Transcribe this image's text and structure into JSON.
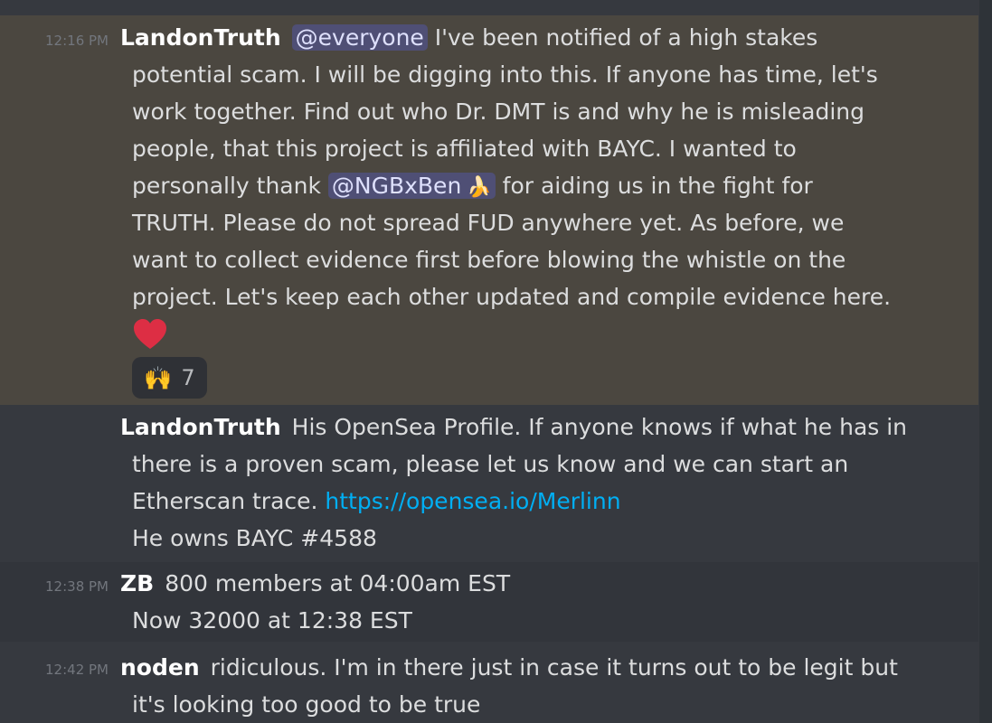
{
  "messages": [
    {
      "time": "12:16 PM",
      "author": "LandonTruth",
      "mention1": "@everyone",
      "line1_rest": " I've been notified of a high stakes",
      "line2": "potential scam.  I will be digging into this.  If anyone has time, let's",
      "line3": "work together. Find out who Dr. DMT is and why he is misleading",
      "line4": "people, that this project is affiliated with BAYC.  I wanted to",
      "line5_pre": "personally thank ",
      "mention2": "@NGBxBen",
      "mention2_emoji": "🍌",
      "line5_post": " for aiding us in the fight for",
      "line6": "TRUTH.  Please do not spread FUD anywhere yet. As before, we",
      "line7": "want to collect evidence first before blowing the whistle on the",
      "line8": "project.  Let's keep each other updated and compile evidence here.",
      "reaction_emoji": "🙌",
      "reaction_count": "7"
    },
    {
      "author": "LandonTruth",
      "line1_rest": "His OpenSea Profile.  If anyone knows if what he has in",
      "line2": "there is a proven scam, please let us know and we can start an",
      "line3_pre": "Etherscan trace.  ",
      "link": "https://opensea.io/Merlinn",
      "line4": " He owns BAYC #4588"
    },
    {
      "time": "12:38 PM",
      "author": "ZB",
      "line1_rest": "800 members at 04:00am EST",
      "line2": "Now 32000 at 12:38 EST"
    },
    {
      "time": "12:42 PM",
      "author": "noden",
      "line1_rest": "ridiculous. I'm in there just in case it turns out to be legit but",
      "line2": "it's looking too good to be true"
    }
  ],
  "colors": {
    "background": "#36393f",
    "highlight": "#4b4740",
    "mention_bg": "#454d83",
    "link": "#00aff4",
    "timestamp": "#72767d"
  }
}
